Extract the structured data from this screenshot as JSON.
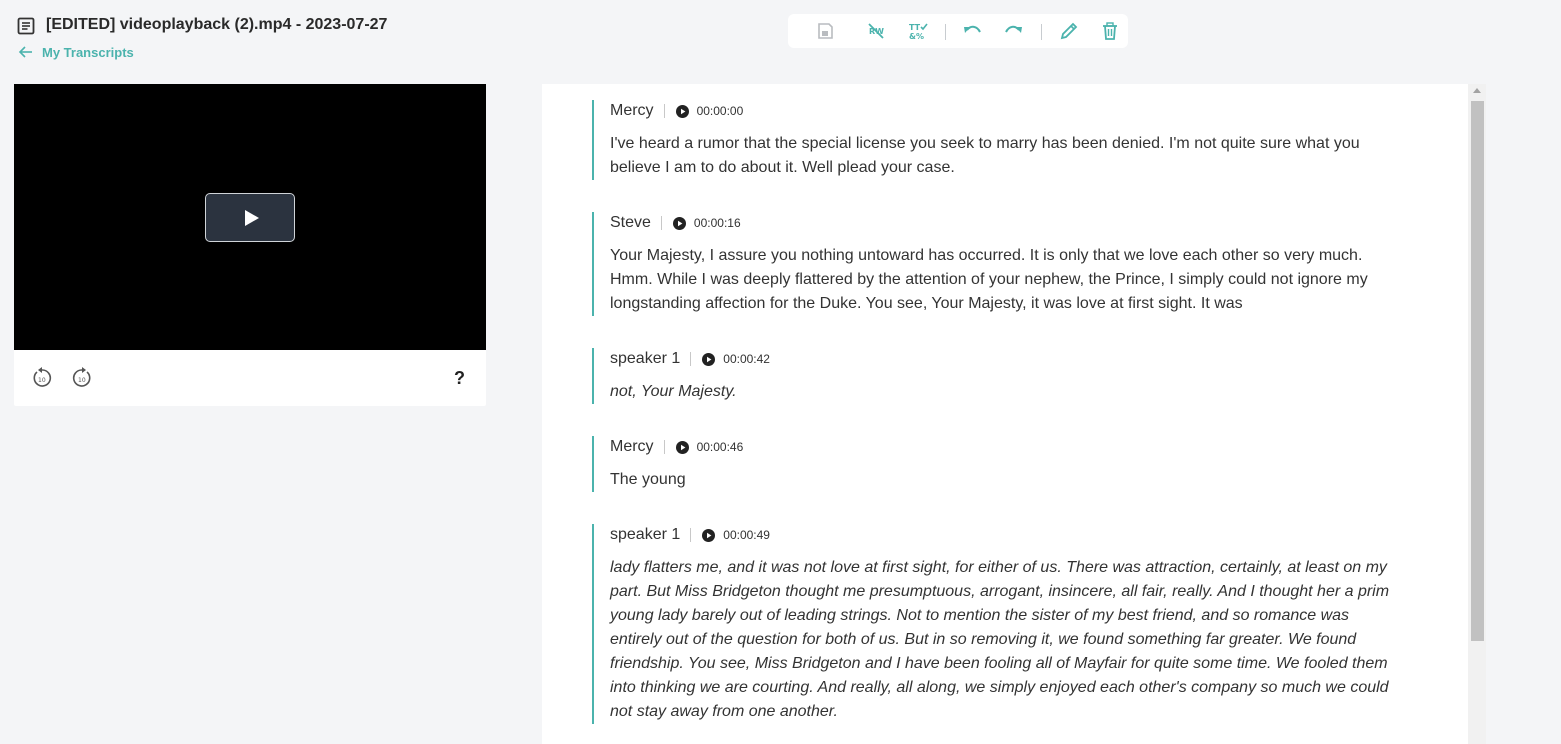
{
  "header": {
    "title": "[EDITED] videoplayback (2).mp4 - 2023-07-27",
    "back_link": "My Transcripts"
  },
  "toolbar": {
    "accent": "#4bb3ad",
    "buttons": [
      "save-icon",
      "clear-formatting-icon",
      "find-replace-icon",
      "undo-icon",
      "redo-icon",
      "edit-icon",
      "delete-icon"
    ]
  },
  "player": {
    "help": "?"
  },
  "segments": [
    {
      "speaker": "Mercy",
      "time": "00:00:00",
      "italic": false,
      "text": "I've heard a rumor that the special license you seek to marry has been denied. I'm not quite sure what you believe I am to do about it. Well plead your case."
    },
    {
      "speaker": "Steve",
      "time": "00:00:16",
      "italic": false,
      "text": "Your Majesty, I assure you nothing untoward has occurred. It is only that we love each other so very much. Hmm. While I was deeply flattered by the attention of your nephew, the Prince, I simply could not ignore my longstanding affection for the Duke. You see, Your Majesty, it was love at first sight. It was"
    },
    {
      "speaker": "speaker 1",
      "time": "00:00:42",
      "italic": true,
      "text": "not, Your Majesty."
    },
    {
      "speaker": "Mercy",
      "time": "00:00:46",
      "italic": false,
      "text": "The young"
    },
    {
      "speaker": "speaker 1",
      "time": "00:00:49",
      "italic": true,
      "text": "lady flatters me, and it was not love at first sight, for either of us. There was attraction, certainly, at least on my part. But Miss Bridgeton thought me presumptuous, arrogant, insincere, all fair, really. And I thought her a prim young lady barely out of leading strings. Not to mention the sister of my best friend, and so romance was entirely out of the question for both of us. But in so removing it, we found something far greater. We found friendship. You see, Miss Bridgeton and I have been fooling all of Mayfair for quite some time. We fooled them into thinking we are courting. And really, all along, we simply enjoyed each other's company so much we could not stay away from one another."
    }
  ]
}
